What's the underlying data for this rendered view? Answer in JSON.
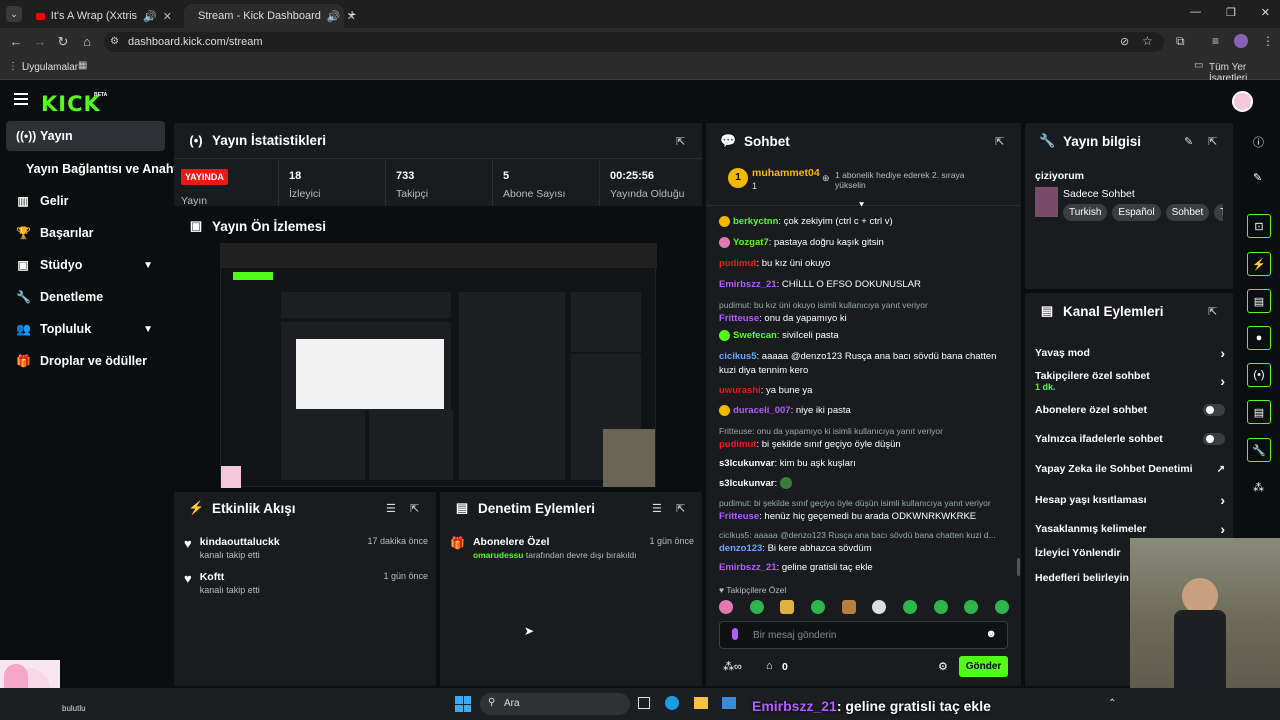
{
  "browser": {
    "tabs": [
      {
        "title": "It's A Wrap (Xxtristanxo Full",
        "icon": "youtube-icon"
      },
      {
        "title": "Stream - Kick Dashboard",
        "icon": "kick-icon"
      }
    ],
    "url": "dashboard.kick.com/stream",
    "bookmarks_apps": "Uygulamalar",
    "bookmarks_all": "Tüm Yer İşaretleri"
  },
  "brand": {
    "logo": "KICK",
    "beta": "BETA",
    "accent": "#53fc18"
  },
  "sidebar": {
    "items": [
      {
        "label": "Yayın",
        "icon": "broadcast-icon"
      },
      {
        "label": "Yayın Bağlantısı ve Anahtarı",
        "icon": ""
      },
      {
        "label": "Gelir",
        "icon": "chart-icon"
      },
      {
        "label": "Başarılar",
        "icon": "trophy-icon"
      },
      {
        "label": "Stüdyo",
        "icon": "studio-icon"
      },
      {
        "label": "Denetleme",
        "icon": "wrench-icon"
      },
      {
        "label": "Topluluk",
        "icon": "people-icon"
      },
      {
        "label": "Droplar ve ödüller",
        "icon": "gift-icon"
      }
    ]
  },
  "stats": {
    "title": "Yayın İstatistikleri",
    "live_badge": "YAYINDA",
    "live_label": "Yayın",
    "items": [
      {
        "value": "18",
        "label": "İzleyici"
      },
      {
        "value": "733",
        "label": "Takipçi"
      },
      {
        "value": "5",
        "label": "Abone Sayısı"
      },
      {
        "value": "00:25:56",
        "label": "Yayında Olduğu"
      }
    ]
  },
  "preview": {
    "title": "Yayın Ön İzlemesi"
  },
  "activity": {
    "title": "Etkinlik Akışı",
    "events": [
      {
        "user": "kindaouttaluckk",
        "action": "kanalı takip etti",
        "time": "17 dakika önce"
      },
      {
        "user": "Koftt",
        "action": "kanalı takip etti",
        "time": "1 gün önce"
      }
    ]
  },
  "moderation": {
    "title": "Denetim Eylemleri",
    "events": [
      {
        "title": "Abonelere Özel",
        "user": "omarudessu",
        "action": "tarafından devre dışı bırakıldı",
        "time": "1 gün önce"
      }
    ]
  },
  "chat": {
    "title": "Sohbet",
    "pinned": {
      "user": "muhammet04",
      "rank": "1",
      "sub": "1",
      "text": "1 abonelik hediye ederek 2. sıraya yükselin"
    },
    "messages": [
      {
        "reply": "",
        "user": "berkyctnn",
        "color": "#53fc18",
        "text": "çok zekiyim (ctrl c + ctrl v)"
      },
      {
        "reply": "",
        "user": "Yozgat7",
        "color": "#53fc18",
        "text": "pastaya doğru kaşık gitsin"
      },
      {
        "reply": "",
        "user": "pudimut",
        "color": "#e91916",
        "text": "bu kız üni okuyo"
      },
      {
        "reply": "",
        "user": "Emirbszz_21",
        "color": "#b45cff",
        "text": "CHİLLL O EFSO DOKUNUSLAR"
      },
      {
        "reply": "pudimut: bu kız üni okuyo isimli kullanıcıya yanıt veriyor",
        "user": "Fritteuse",
        "color": "#b45cff",
        "text": "onu da yapamıyo ki"
      },
      {
        "reply": "",
        "user": "Swefecan",
        "color": "#53fc18",
        "text": "siviIceli pasta"
      },
      {
        "reply": "",
        "user": "cicikus5",
        "color": "#6aa8ff",
        "text": "aaaaa @denzo123 Rusça ana bacı sövdü bana chatten kuzi diya tennim kero"
      },
      {
        "reply": "",
        "user": "uwurashi",
        "color": "#e91916",
        "text": "ya bune ya"
      },
      {
        "reply": "",
        "user": "duraceli_007",
        "color": "#b45cff",
        "text": "niye iki pasta"
      },
      {
        "reply": "Fritteuse: onu da yapamıyo ki isimli kullanıcıya yanıt veriyor",
        "user": "pudimut",
        "color": "#e91916",
        "text": "bi şekilde sınıf geçiyo öyle düşün"
      },
      {
        "reply": "",
        "user": "s3lcukunvar",
        "color": "#ffffff",
        "text": "kim bu aşk kuşları"
      },
      {
        "reply": "",
        "user": "s3lcukunvar",
        "color": "#ffffff",
        "text": ""
      },
      {
        "reply": "pudimut: bi şekilde sınıf geçiyo öyle düşün isimli kullanıcıya yanıt veriyor",
        "user": "Fritteuse",
        "color": "#b45cff",
        "text": "henüz hiç geçemedi bu arada ODKWNRKWKRKE"
      },
      {
        "reply": "cicikus5: aaaaa @denzo123 Rusça ana bacı sövdü bana chatten kuzi d...",
        "user": "denzo123",
        "color": "#6aa8ff",
        "text": "Bi kere abhazca sövdüm"
      },
      {
        "reply": "",
        "user": "Emirbszz_21",
        "color": "#b45cff",
        "text": "geline gratisli taç ekle"
      }
    ],
    "followers_only": "Takipçilere Özel",
    "input_placeholder": "Bir mesaj gönderin",
    "points": "0",
    "send_label": "Gönder"
  },
  "stream_info": {
    "title": "Yayın bilgisi",
    "stream_title": "çiziyorum",
    "category": "Sadece Sohbet",
    "tags": [
      "Turkish",
      "Español",
      "Sohbet",
      "Tü"
    ]
  },
  "channel_actions": {
    "title": "Kanal Eylemleri",
    "items": [
      {
        "label": "Yavaş mod",
        "sub": "",
        "control": "chevron"
      },
      {
        "label": "Takipçilere özel sohbet",
        "sub": "1 dk.",
        "control": "chevron"
      },
      {
        "label": "Abonelere özel sohbet",
        "sub": "",
        "control": "toggle"
      },
      {
        "label": "Yalnızca ifadelerle sohbet",
        "sub": "",
        "control": "toggle"
      },
      {
        "label": "Yapay Zeka ile Sohbet Denetimi",
        "sub": "",
        "control": "external"
      },
      {
        "label": "Hesap yaşı kısıtlaması",
        "sub": "",
        "control": "chevron"
      },
      {
        "label": "Yasaklanmış kelimeler",
        "sub": "",
        "control": "chevron"
      },
      {
        "label": "İzleyici Yönlendir",
        "sub": "",
        "control": ""
      },
      {
        "label": "Hedefleri belirleyin",
        "sub": "",
        "control": ""
      }
    ]
  },
  "taskbar": {
    "weather": "bulutlu",
    "search": "Ara",
    "overlay_user": "Emirbszz_21",
    "overlay_text": ": geline gratisli taç ekle"
  }
}
